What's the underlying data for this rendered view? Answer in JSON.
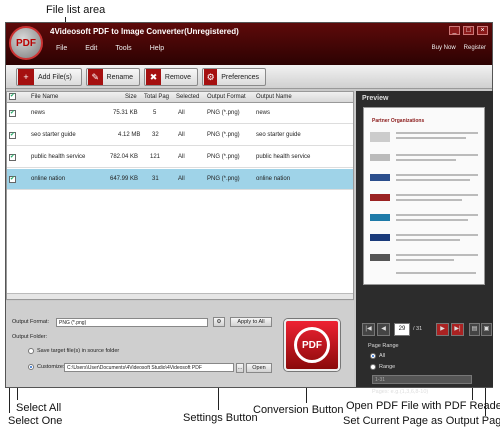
{
  "callouts": {
    "file_list_area": "File list area",
    "select_all": "Select All",
    "select_one": "Select One",
    "settings_button": "Settings Button",
    "conversion_button": "Conversion Button",
    "open_pdf": "Open PDF File with PDF Reader",
    "set_current_page": "Set Current Page as Output Page"
  },
  "window": {
    "logo": "PDF",
    "title": "4Videosoft PDF to Image Converter(Unregistered)",
    "menu": [
      "File",
      "Edit",
      "Tools",
      "Help"
    ],
    "buy_now": "Buy Now",
    "register": "Register",
    "controls": [
      "_",
      "□",
      "×"
    ]
  },
  "toolbar": {
    "add_label": "Add File(s)",
    "rename_label": "Rename",
    "remove_label": "Remove",
    "preferences_label": "Preferences"
  },
  "table": {
    "headers": [
      "File Name",
      "Size",
      "Total Pag",
      "Selected",
      "Output Format",
      "Output Name"
    ],
    "rows": [
      {
        "name": "news",
        "size": "75.31 KB",
        "pages": "5",
        "selected": "All",
        "format": "PNG (*.png)",
        "output": "news"
      },
      {
        "name": "seo starter guide",
        "size": "4.12 MB",
        "pages": "32",
        "selected": "All",
        "format": "PNG (*.png)",
        "output": "seo starter guide"
      },
      {
        "name": "public health service",
        "size": "782.04 KB",
        "pages": "121",
        "selected": "All",
        "format": "PNG (*.png)",
        "output": "public health service"
      },
      {
        "name": "online nation",
        "size": "647.99 KB",
        "pages": "31",
        "selected": "All",
        "format": "PNG (*.png)",
        "output": "online nation"
      }
    ]
  },
  "bottom": {
    "output_format_label": "Output Format:",
    "output_format_value": "PNG (*.png)",
    "apply_all": "Apply to All",
    "output_folder_label": "Output Folder:",
    "save_source": "Save target file(s) in source folder",
    "customize": "Customize:",
    "path": "C:\\Users\\User\\Documents\\4Videosoft Studio\\4Videosoft PDF",
    "open": "Open",
    "convert_label": "PDF"
  },
  "preview": {
    "title": "Preview",
    "doc_header": "Partner Organizations",
    "current_page": "29",
    "total_pages": "/ 31",
    "page_range": "Page Range",
    "all": "All",
    "range": "Range",
    "range_value": "1-31",
    "pages_hint": "Pages: e.g.(1,3,6,8-10)"
  }
}
